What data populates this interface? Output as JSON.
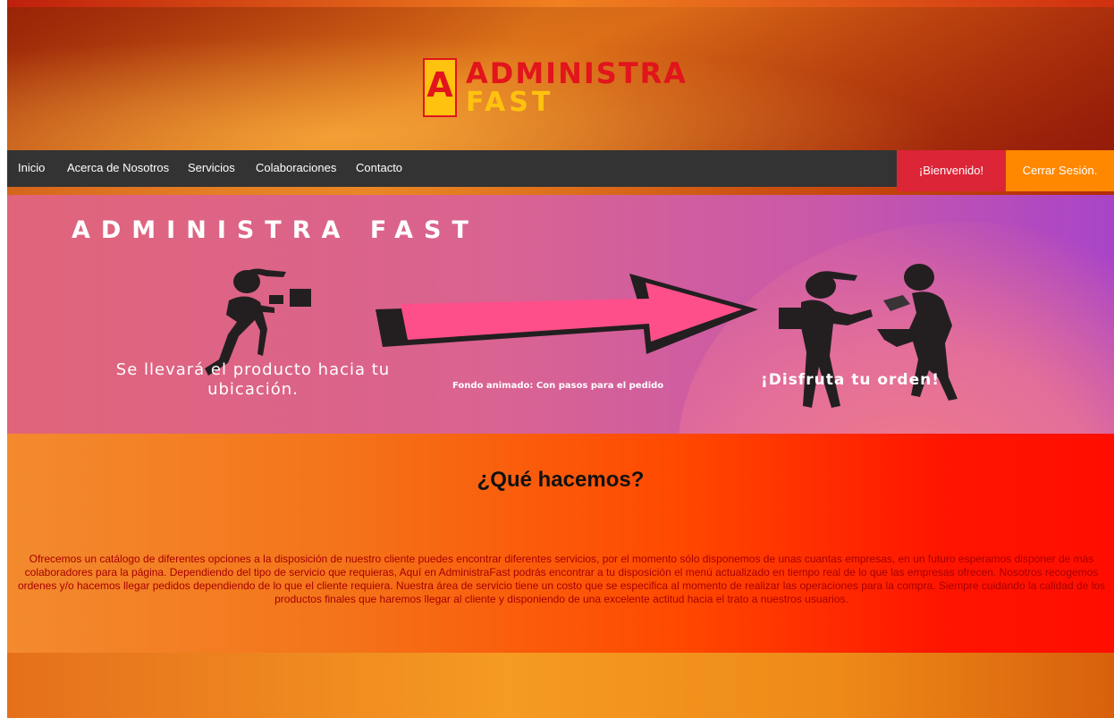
{
  "brand": {
    "logo_letter": "A",
    "logo_line1": "ADMINISTRA",
    "logo_line2": "FAST"
  },
  "nav": {
    "items": [
      {
        "label": "Inicio"
      },
      {
        "label": "Acerca de Nosotros"
      },
      {
        "label": "Servicios"
      },
      {
        "label": "Colaboraciones"
      },
      {
        "label": "Contacto"
      }
    ],
    "welcome_label": "¡Bienvenido!",
    "logout_label": "Cerrar Sesión."
  },
  "banner": {
    "title": "ADMINISTRA FAST",
    "left_text": "Se llevará  el producto hacia tu ubicación.",
    "caption": "Fondo animado: Con pasos para el pedido",
    "right_text": "¡Disfruta tu orden!"
  },
  "about": {
    "title": "¿Qué hacemos?",
    "text": "Ofrecemos un catálogo de diferentes opciones a la disposición de nuestro cliente puedes encontrar diferentes servicios, por el momento sólo disponemos de unas cuantas empresas, en un futuro esperamos disponer de más colaboradores para la página. Dependiendo del tipo de servicio que requieras, Aquí en AdministraFast podrás encontrar a tu disposición el menú actualizado en tiempo real de lo que las empresas ofrecen. Nosotros recogemos ordenes y/o hacemos llegar pedidos dependiendo de lo que el cliente requiera. Nuestra área de servicio tiene un costo que se especifica al momento de realizar las operaciones para la compra. Siempre cuidando la calidad de los productos finales que haremos llegar al cliente y disponiendo de una excelente actitud hacia el trato a nuestros usuarios."
  },
  "colors": {
    "nav_bg": "#333333",
    "welcome_bg": "#dc2537",
    "logout_bg": "#ff8800",
    "arrow_fill": "#ff4f8b",
    "logo_red": "#e2141c",
    "logo_yellow": "#ffc20e"
  },
  "icons": [
    "delivery-man-icon",
    "arrow-right-icon",
    "handover-icon"
  ]
}
